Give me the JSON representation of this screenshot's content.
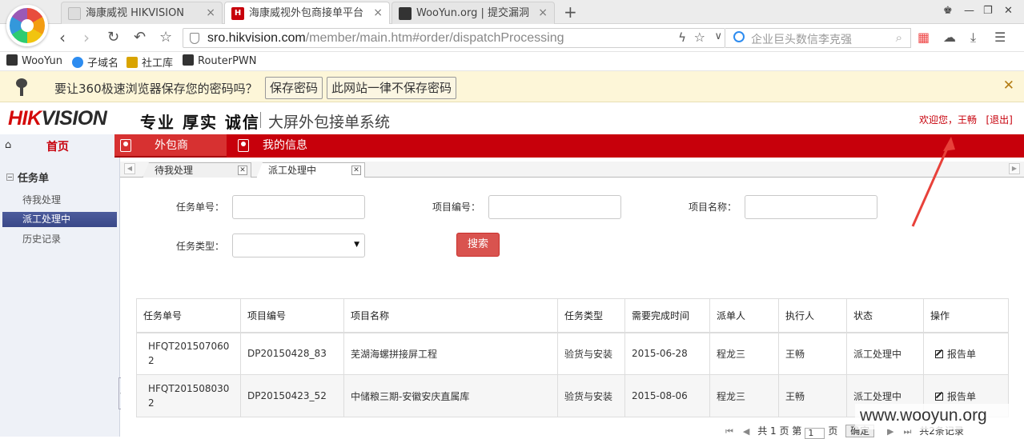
{
  "browser": {
    "tabs": [
      {
        "title": "海康威视 HIKVISION",
        "active": false
      },
      {
        "title": "海康威视外包商接单平台",
        "active": true
      },
      {
        "title": "WooYun.org | 提交漏洞",
        "active": false
      }
    ],
    "url_domain": "sro.hikvision.com",
    "url_path": "/member/main.htm#order/dispatchProcessing",
    "search_placeholder": "企业巨头数信李克强",
    "bookmarks": [
      "WooYun",
      "子域名",
      "社工库",
      "RouterPWN"
    ],
    "password_prompt": {
      "text": "要让360极速浏览器保存您的密码吗？",
      "save_label": "保存密码",
      "never_label": "此网站一律不保存密码"
    }
  },
  "header": {
    "logo_hik": "HIK",
    "logo_vision": "VISION",
    "slogan": "专业 厚实 诚信",
    "system_name": "大屏外包接单系统",
    "welcome": "欢迎您，王畅",
    "logout": "[退出]"
  },
  "sidebar": {
    "home": "首页",
    "group": "任务单",
    "items": [
      {
        "label": "待我处理",
        "active": false
      },
      {
        "label": "派工处理中",
        "active": true
      },
      {
        "label": "历史记录",
        "active": false
      }
    ]
  },
  "topnav": {
    "items": [
      {
        "label": "外包商",
        "active": true
      },
      {
        "label": "我的信息",
        "active": false
      }
    ]
  },
  "page_tabs": [
    {
      "label": "待我处理",
      "active": false
    },
    {
      "label": "派工处理中",
      "active": true
    }
  ],
  "filters": {
    "task_no_label": "任务单号：",
    "project_no_label": "项目编号：",
    "project_name_label": "项目名称：",
    "task_type_label": "任务类型：",
    "task_no_value": "",
    "project_no_value": "",
    "project_name_value": "",
    "task_type_value": "",
    "search_label": "搜索"
  },
  "table": {
    "columns": [
      "任务单号",
      "项目编号",
      "项目名称",
      "任务类型",
      "需要完成时间",
      "派单人",
      "执行人",
      "状态",
      "操作"
    ],
    "rows": [
      {
        "task_no_a": "HFQT201507060",
        "task_no_b": "2",
        "project_no": "DP20150428_83",
        "project_name": "芜湖海螺拼接屏工程",
        "task_type": "验货与安装",
        "due": "2015-06-28",
        "dispatcher": "程龙三",
        "executor": "王畅",
        "status": "派工处理中",
        "action": "报告单"
      },
      {
        "task_no_a": "HFQT201508030",
        "task_no_b": "2",
        "project_no": "DP20150423_52",
        "project_name": "中储粮三期-安徽安庆直属库",
        "task_type": "验货与安装",
        "due": "2015-08-06",
        "dispatcher": "程龙三",
        "executor": "王畅",
        "status": "派工处理中",
        "action": "报告单"
      }
    ]
  },
  "pager": {
    "total_pages": "共 1 页",
    "page_prefix": "第",
    "page_value": "1",
    "page_suffix": "页",
    "confirm": "确定",
    "total_records": "共2条记录"
  },
  "watermark": "www.wooyun.org",
  "colors": {
    "brand_red": "#c7000b",
    "active_blue": "#3a4888",
    "search_btn": "#d9534f"
  }
}
